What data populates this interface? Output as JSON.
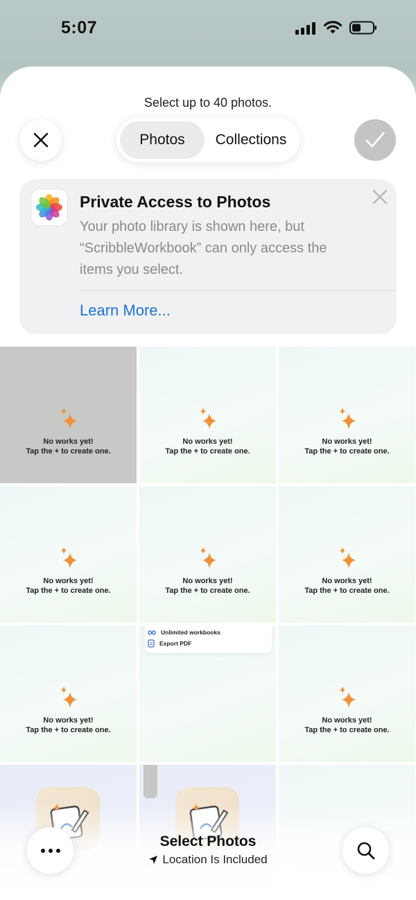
{
  "status_bar": {
    "time": "5:07",
    "icons": [
      "cellular-signal-icon",
      "wifi-icon",
      "battery-icon"
    ]
  },
  "sheet": {
    "hint": "Select up to 40 photos.",
    "close_icon": "close-icon",
    "confirm_icon": "checkmark-icon",
    "tabs": [
      {
        "label": "Photos",
        "selected": true
      },
      {
        "label": "Collections",
        "selected": false
      }
    ]
  },
  "banner": {
    "icon": "photos-app-icon",
    "title": "Private Access to Photos",
    "lines": [
      "Your photo library is shown here, but",
      "“ScribbleWorkbook” can only access the",
      "items you select."
    ],
    "link": "Learn More...",
    "dismiss_icon": "close-icon"
  },
  "grid": {
    "empty_message_line1": "No works yet!",
    "empty_message_line2": "Tap the + to create one.",
    "features": [
      {
        "icon": "infinity-icon",
        "label": "Unlimited workbooks"
      },
      {
        "icon": "document-icon",
        "label": "Export PDF"
      }
    ],
    "accent_color": "#f0913a"
  },
  "bottom": {
    "title": "Select Photos",
    "subtitle": "Location Is Included",
    "more_icon": "more-icon",
    "search_icon": "search-icon",
    "location_icon": "location-arrow-icon"
  }
}
